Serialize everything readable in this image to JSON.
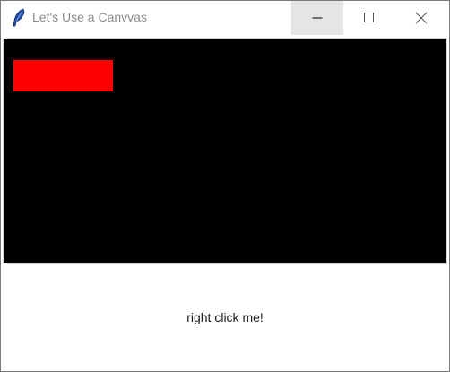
{
  "window": {
    "title": "Let's Use a Canvvas",
    "controls": {
      "minimize": "minimize-icon",
      "maximize": "maximize-icon",
      "close": "close-icon"
    }
  },
  "canvas": {
    "background": "#000000",
    "shape_color": "#ff0000"
  },
  "label": {
    "text": "right click me!"
  }
}
